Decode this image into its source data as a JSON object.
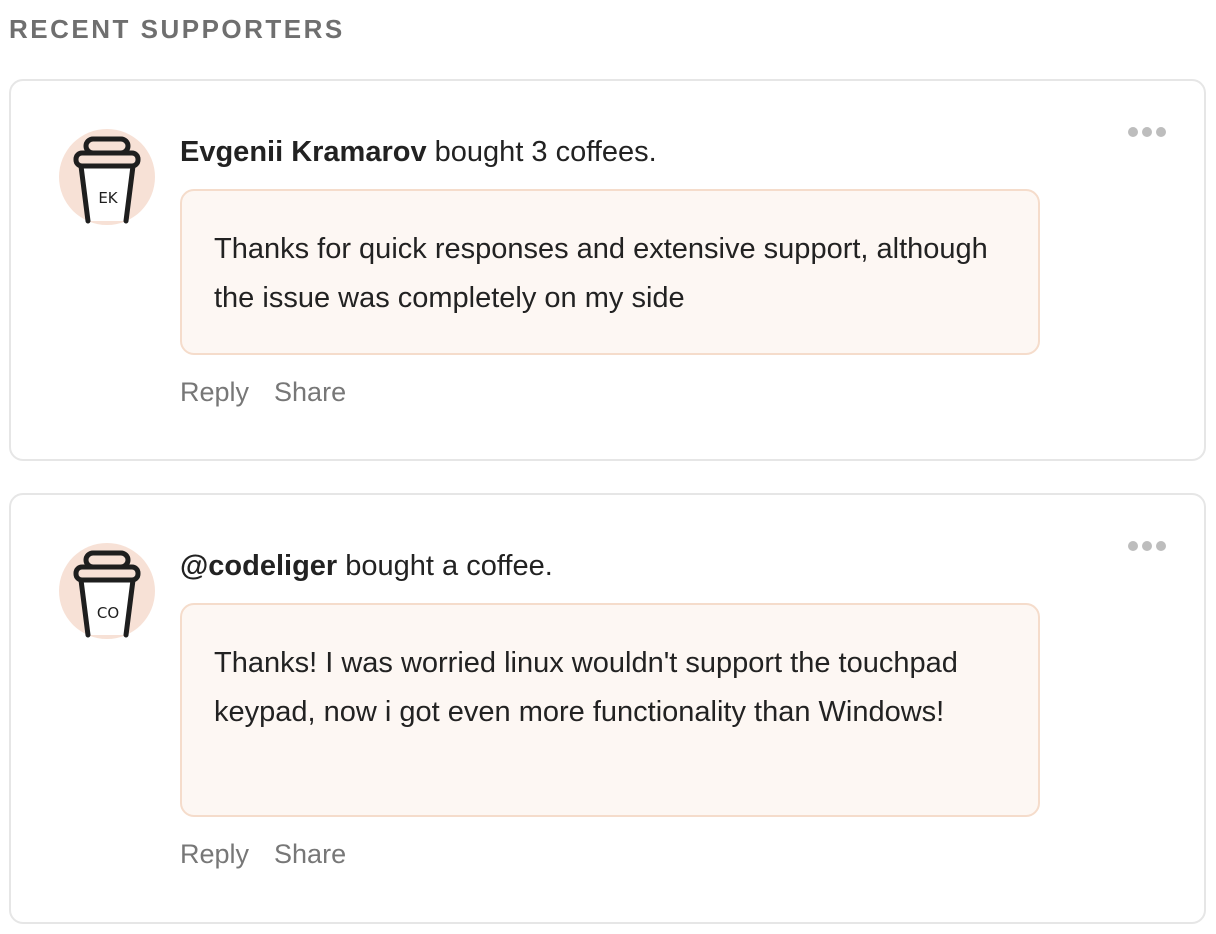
{
  "section": {
    "title": "RECENT SUPPORTERS"
  },
  "supporters": [
    {
      "name": "Evgenii Kramarov",
      "action": "bought 3 coffees.",
      "avatar_initials": "EK",
      "message": "Thanks for quick responses and extensive support, although the issue was completely on my side",
      "reply_label": "Reply",
      "share_label": "Share",
      "avatar_icon": "coffee-cup-icon",
      "more_icon": "more-options-icon"
    },
    {
      "name": "@codeliger",
      "action": "bought a coffee.",
      "avatar_initials": "CO",
      "message": "Thanks! I was worried linux wouldn't support the touchpad keypad, now i got even more functionality than Windows!",
      "reply_label": "Reply",
      "share_label": "Share",
      "avatar_icon": "coffee-cup-icon",
      "more_icon": "more-options-icon"
    }
  ],
  "colors": {
    "heading": "#6f6f6f",
    "bubble_bg": "#fdf7f3",
    "bubble_border": "#f5dccb",
    "avatar_bg": "#f7e1d6",
    "link": "#777777"
  }
}
